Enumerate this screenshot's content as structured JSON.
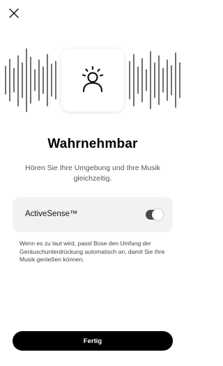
{
  "header": {
    "close_icon": "close-icon"
  },
  "hero": {
    "icon": "aware-mode-person-icon"
  },
  "title": "Wahrnehmbar",
  "subtitle": "Hören Sie Ihre Umgebung und Ihre Musik gleichzeitig.",
  "active_sense": {
    "label": "ActiveSense™",
    "enabled": true
  },
  "description": "Wenn es zu laut wird, passt Bose den Umfang der Geräuschunterdrückung automatisch an, damit Sie Ihre Musik genießen können.",
  "footer": {
    "done_label": "Fertig"
  },
  "colors": {
    "background": "#ffffff",
    "button": "#000000",
    "card": "#f2f2f2",
    "toggle_on": "#4a4a4a"
  }
}
